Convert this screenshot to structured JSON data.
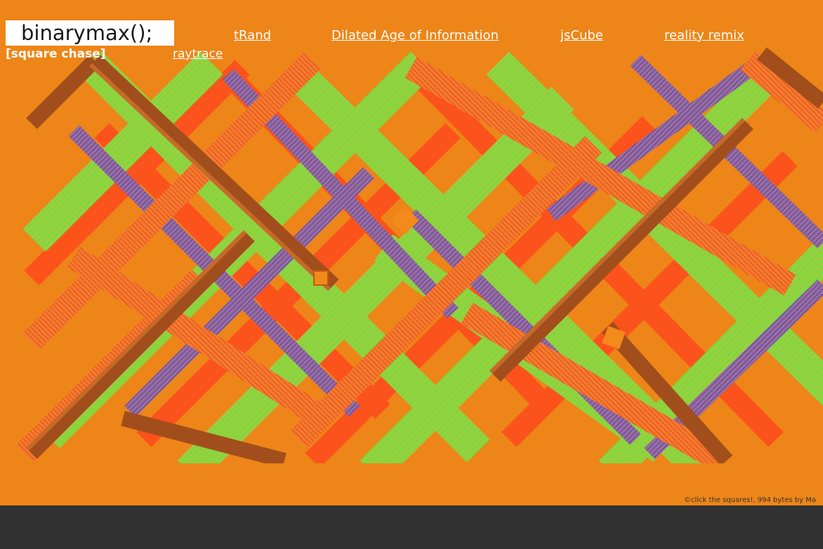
{
  "site": {
    "logo": "binarymax();"
  },
  "nav": {
    "links": [
      {
        "label": "tRand"
      },
      {
        "label": "Dilated Age of Information"
      },
      {
        "label": "jsCube"
      },
      {
        "label": "reality remix"
      }
    ],
    "active": {
      "label": "[square chase]"
    },
    "second_row": [
      {
        "label": "raytrace"
      }
    ]
  },
  "footer": {
    "text": "©click the squares!, 994 bytes by Ma"
  },
  "colors": {
    "background": "#ED8518",
    "bottom_bar": "#323232",
    "link": "#ffffff",
    "art_brown": "#A9501C",
    "art_orange": "#FF5A1A",
    "art_green": "#6BE830",
    "art_blue": "#4B3BD8"
  }
}
